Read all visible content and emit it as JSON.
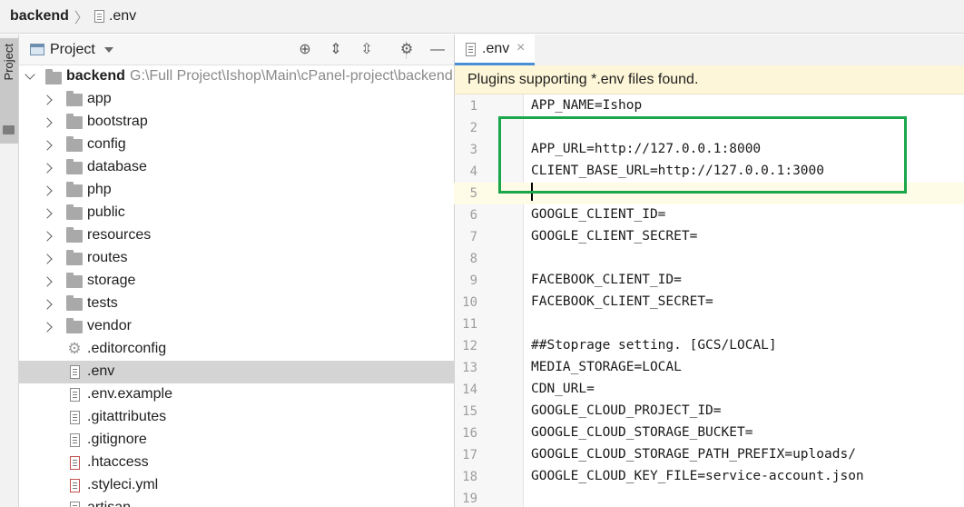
{
  "breadcrumb": {
    "root": "backend",
    "file": ".env"
  },
  "side_strip": {
    "tab_label": "Project"
  },
  "project_panel": {
    "title": "Project",
    "toolbar": [
      {
        "name": "locate-icon",
        "glyph": "⊕"
      },
      {
        "name": "expand-all-icon",
        "glyph": "⇕"
      },
      {
        "name": "collapse-all-icon",
        "glyph": "⇳"
      },
      {
        "name": "gear-icon",
        "glyph": "⚙"
      },
      {
        "name": "hide-icon",
        "glyph": "—"
      }
    ]
  },
  "tree": {
    "root": {
      "name": "backend",
      "path": "G:\\Full Project\\Ishop\\Main\\cPanel-project\\backend"
    },
    "folders": [
      "app",
      "bootstrap",
      "config",
      "database",
      "php",
      "public",
      "resources",
      "routes",
      "storage",
      "tests",
      "vendor"
    ],
    "files": [
      ".editorconfig",
      ".env",
      ".env.example",
      ".gitattributes",
      ".gitignore",
      ".htaccess",
      ".styleci.yml",
      "artisan"
    ],
    "selected": ".env"
  },
  "editor": {
    "tab_label": ".env",
    "tab_close": "×",
    "banner": "Plugins supporting *.env files found.",
    "lines": [
      "APP_NAME=Ishop",
      "",
      "APP_URL=http://127.0.0.1:8000",
      "CLIENT_BASE_URL=http://127.0.0.1:3000",
      "",
      "GOOGLE_CLIENT_ID=",
      "GOOGLE_CLIENT_SECRET=",
      "",
      "FACEBOOK_CLIENT_ID=",
      "FACEBOOK_CLIENT_SECRET=",
      "",
      "##Stoprage setting. [GCS/LOCAL]",
      "MEDIA_STORAGE=LOCAL",
      "CDN_URL=",
      "GOOGLE_CLOUD_PROJECT_ID=",
      "GOOGLE_CLOUD_STORAGE_BUCKET=",
      "GOOGLE_CLOUD_STORAGE_PATH_PREFIX=uploads/",
      "GOOGLE_CLOUD_KEY_FILE=service-account.json",
      ""
    ],
    "line_numbers": [
      "1",
      "2",
      "3",
      "4",
      "5",
      "6",
      "7",
      "8",
      "9",
      "10",
      "11",
      "12",
      "13",
      "14",
      "15",
      "16",
      "17",
      "18",
      "19"
    ],
    "current_line": 5,
    "highlight_color": "#1aa64a"
  }
}
